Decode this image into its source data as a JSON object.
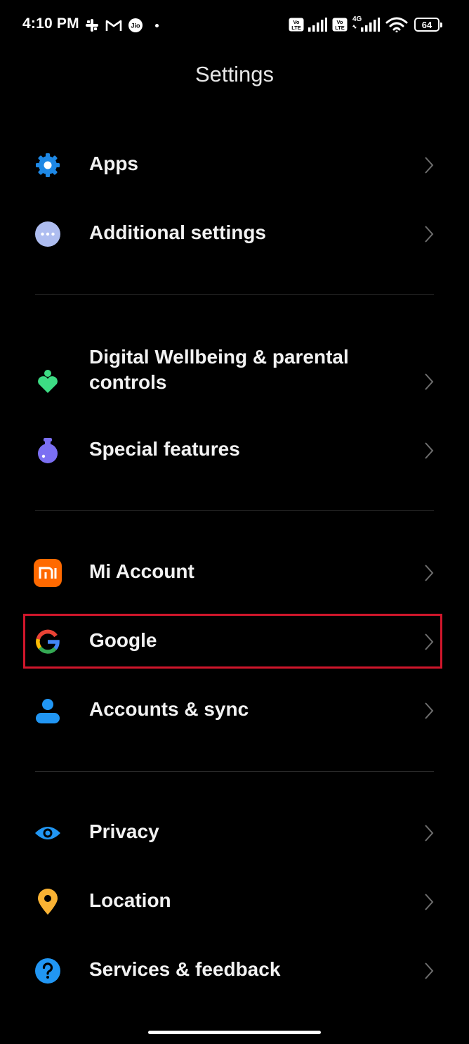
{
  "status_bar": {
    "time": "4:10 PM",
    "battery": "64",
    "network": "4G"
  },
  "title": "Settings",
  "rows": {
    "apps": "Apps",
    "additional": "Additional settings",
    "wellbeing": "Digital Wellbeing & parental controls",
    "special": "Special features",
    "mi_account": "Mi Account",
    "google": "Google",
    "accounts_sync": "Accounts & sync",
    "privacy": "Privacy",
    "location": "Location",
    "services": "Services & feedback"
  },
  "colors": {
    "background": "#000000",
    "apps_icon": "#1e88e5",
    "additional_icon": "#aebdf0",
    "wellbeing_icon": "#3ddc84",
    "special_icon": "#7b6ff2",
    "mi_icon": "#ff6900",
    "accounts_icon": "#2196f3",
    "privacy_icon": "#2196f3",
    "location_icon": "#f9b233",
    "services_icon": "#2196f3",
    "highlight": "#d0162b"
  }
}
